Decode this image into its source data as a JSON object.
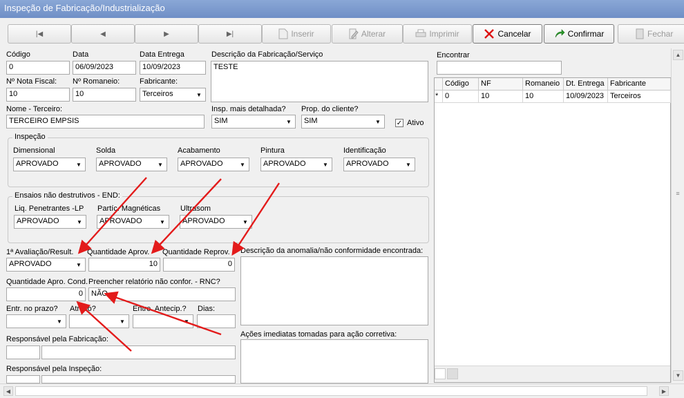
{
  "window": {
    "title": "Inspeção de Fabricação/Industrialização"
  },
  "toolbar": {
    "nav_icons": [
      "first-record-icon",
      "prev-record-icon",
      "next-record-icon",
      "last-record-icon"
    ],
    "first": "|◀",
    "prev": "◀",
    "next": "▶",
    "last": "▶|",
    "inserir": "Inserir",
    "alterar": "Alterar",
    "imprimir": "Imprimir",
    "cancelar": "Cancelar",
    "confirmar": "Confirmar",
    "fechar": "Fechar"
  },
  "form": {
    "codigo": {
      "label": "Código",
      "value": "0"
    },
    "data": {
      "label": "Data",
      "value": "06/09/2023"
    },
    "data_entrega": {
      "label": "Data Entrega",
      "value": "10/09/2023"
    },
    "descricao": {
      "label": "Descrição da Fabricação/Serviço",
      "value": "TESTE"
    },
    "nota_fiscal": {
      "label": "Nº Nota Fiscal:",
      "value": "10"
    },
    "romaneio": {
      "label": "Nº Romaneio:",
      "value": "10"
    },
    "fabricante": {
      "label": "Fabricante:",
      "value": "Terceiros"
    },
    "nome_terceiro": {
      "label": "Nome - Terceiro:",
      "value": "TERCEIRO EMPSIS"
    },
    "insp_detalhada": {
      "label": "Insp. mais detalhada?",
      "value": "SIM"
    },
    "prop_cliente": {
      "label": "Prop. do cliente?",
      "value": "SIM"
    },
    "ativo": {
      "label": "Ativo",
      "checked": "✓"
    },
    "inspecao": {
      "title": "Inspeção",
      "dimensional": {
        "label": "Dimensional",
        "value": "APROVADO"
      },
      "solda": {
        "label": "Solda",
        "value": "APROVADO"
      },
      "acabamento": {
        "label": "Acabamento",
        "value": "APROVADO"
      },
      "pintura": {
        "label": "Pintura",
        "value": "APROVADO"
      },
      "identificacao": {
        "label": "Identificação",
        "value": "APROVADO"
      }
    },
    "ensaios": {
      "title": "Ensaios não destrutivos - END:",
      "liq_penetrantes": {
        "label": "Liq. Penetrantes -LP",
        "value": "APROVADO"
      },
      "partic_magneticas": {
        "label": "Partíc. Magnéticas",
        "value": "APROVADO"
      },
      "ultrasom": {
        "label": "Ultrasom",
        "value": "APROVADO"
      }
    },
    "avaliacao": {
      "label": "1ª Avaliação/Result.",
      "value": "APROVADO"
    },
    "qtd_aprov": {
      "label": "Quantidade Aprov.",
      "value": "10"
    },
    "qtd_reprov": {
      "label": "Quantidade Reprov.",
      "value": "0"
    },
    "descricao_anomalia": {
      "label": "Descrição da anomalia/não conformidade encontrada:",
      "value": ""
    },
    "qtd_apro_cond": {
      "label": "Quantidade Apro. Cond.",
      "value": "0"
    },
    "rnc": {
      "label": "Preencher relatório não confor. - RNC?",
      "value": "NÃO"
    },
    "entr_prazo": {
      "label": "Entr. no prazo?",
      "value": ""
    },
    "atraso": {
      "label": "Atraso?",
      "value": ""
    },
    "entre_antecip": {
      "label": "Entre. Antecip.?",
      "value": ""
    },
    "dias": {
      "label": "Dias:",
      "value": ""
    },
    "acoes_imediatas": {
      "label": "Ações imediatas tomadas para ação corretiva:",
      "value": ""
    },
    "resp_fabricacao": {
      "label": "Responsável pela Fabricação:",
      "code": "",
      "name": ""
    },
    "resp_inspecao": {
      "label": "Responsável pela Inspeção:",
      "code": "",
      "name": ""
    }
  },
  "search": {
    "label": "Encontrar",
    "value": ""
  },
  "grid": {
    "columns": [
      "Código",
      "NF",
      "Romaneio",
      "Dt. Entrega",
      "Fabricante"
    ],
    "rows": [
      {
        "marker": "*",
        "cells": [
          "0",
          "10",
          "10",
          "10/09/2023",
          "Terceiros"
        ]
      }
    ]
  },
  "colors": {
    "annotation_arrow": "#e31b1b",
    "title_bar": "#7a99cf"
  }
}
